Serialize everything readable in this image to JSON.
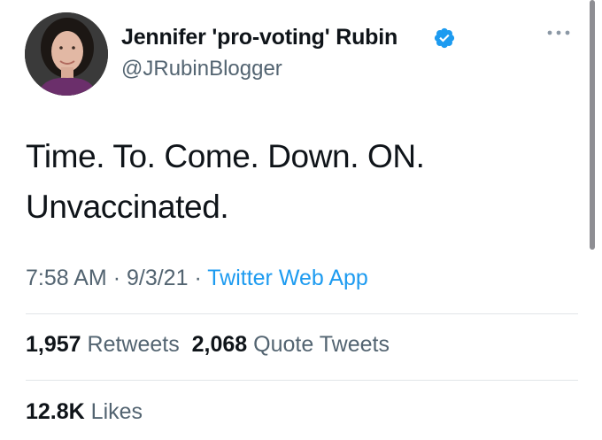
{
  "author": {
    "name": "Jennifer 'pro-voting' Rubin",
    "handle": "@JRubinBlogger",
    "verified_icon": "verified-badge-icon",
    "avatar_icon": "profile-photo"
  },
  "menu": {
    "icon": "more-options-icon"
  },
  "tweet": {
    "text": "Time. To. Come. Down. ON.\nUnvaccinated."
  },
  "meta": {
    "time": "7:58 AM",
    "separator": "·",
    "date": "9/3/21",
    "source": "Twitter Web App"
  },
  "stats": {
    "retweets_count": "1,957",
    "retweets_label": "Retweets",
    "quote_count": "2,068",
    "quote_label": "Quote Tweets",
    "likes_count": "12.8K",
    "likes_label": "Likes"
  },
  "colors": {
    "text": "#0f1419",
    "secondary": "#536471",
    "accent": "#1d9bf0",
    "divider": "#e1e5e8"
  }
}
